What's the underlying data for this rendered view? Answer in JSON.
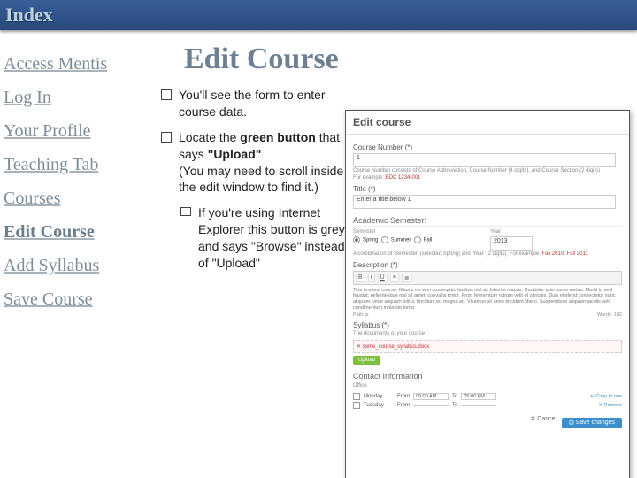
{
  "topbar": {
    "title": "Index"
  },
  "sidebar": {
    "items": [
      {
        "label": "Access Mentis",
        "active": false
      },
      {
        "label": "Log In",
        "active": false
      },
      {
        "label": "Your Profile",
        "active": false
      },
      {
        "label": "Teaching Tab",
        "active": false
      },
      {
        "label": "Courses",
        "active": false
      },
      {
        "label": "Edit Course",
        "active": true
      },
      {
        "label": "Add Syllabus",
        "active": false
      },
      {
        "label": "Save Course",
        "active": false
      }
    ]
  },
  "main": {
    "heading": "Edit Course",
    "bullets": [
      {
        "text": "You'll see the form to enter course data."
      },
      {
        "html": "Locate the <strong>green button</strong> that says <strong>\"Upload\"</strong><br>(You may need to scroll inside the edit window to find it.)",
        "sub": [
          {
            "text": "If you're using Internet Explorer this button is grey and says \"Browse\" instead of \"Upload\""
          }
        ]
      }
    ]
  },
  "screenshot": {
    "title": "Edit course",
    "course_number_label": "Course Number (*)",
    "course_number_value": "1",
    "course_number_hint": "Course Number consists of Course Abbreviation, Course Number (4 digits), and Course Section (2 digits)",
    "course_example_label": "For example:",
    "course_example_value": "EDC 1234-001",
    "title_label": "Title (*)",
    "title_value": "Enter a title below 1",
    "semester_heading": "Academic Semester:",
    "semester_label": "Semester",
    "year_label": "Year",
    "semesters": [
      "Spring",
      "Summer",
      "Fall"
    ],
    "semester_selected": "Spring",
    "year_value": "2013",
    "combo_hint": "A combination of 'Semester' (selected:Spring) and 'Year' (2 digits). For example:",
    "combo_example": "Fall 2010, Fall 2011",
    "desc_label": "Description (*)",
    "lorem": "This is a test course. Mauris eu sem consequat, facilisis nisl at, lobortis mauris. Curabitur quis purus metus. Morbi id velit feugiat, pellentesque nisl sit amet, convallis tortor. Proin fermentum rutrum velit et ultricies. Duis eleifend consectetur nunc aliquam, vitae aliquam tellus, tincidunt eu magna ac. Vivamus sit amet tincidunt libero. Suspendisse aliquam iaculis velit condimentum molestie tortor.",
    "path_label": "Path: p",
    "words_label": "Words: 102",
    "syllabus_label": "Syllabus (*)",
    "syllabus_hint": "The documents of your course",
    "upload_error": "some_course_syllabus.docx",
    "upload_btn": "Upload",
    "contact_heading": "Contact Information",
    "office_label": "Office",
    "days": [
      {
        "name": "Monday",
        "from": "09:00 AM",
        "to": "05:00 PM"
      },
      {
        "name": "Tuesday",
        "from": "",
        "to": ""
      }
    ],
    "from_label": "From",
    "to_label": "To",
    "copy_link": "↵ Copy to one",
    "remove_link": "✕ Remove",
    "save_btn": "⎙ Save changes",
    "cancel_btn": "✕ Cancel"
  }
}
